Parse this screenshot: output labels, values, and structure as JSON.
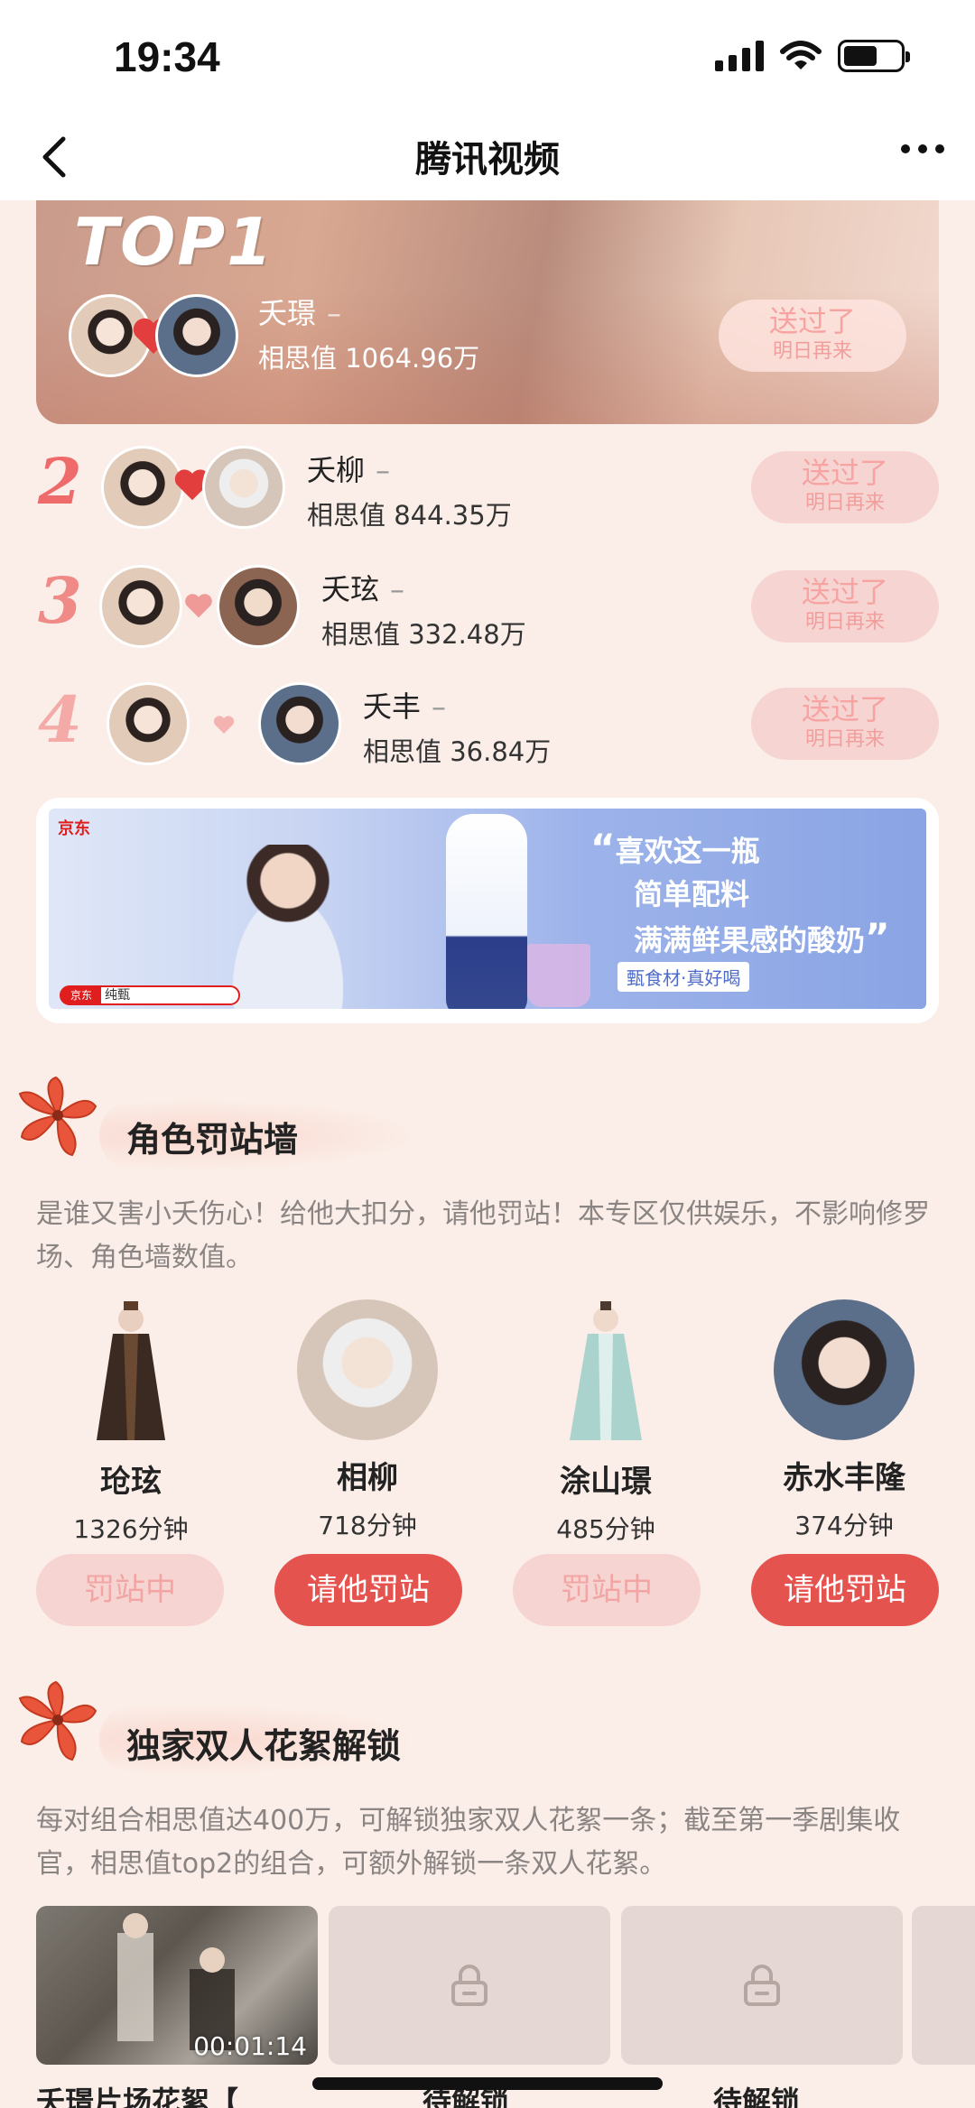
{
  "status_bar": {
    "time": "19:34"
  },
  "nav": {
    "title": "腾讯视频"
  },
  "ranking": {
    "top1": {
      "label": "TOP1",
      "name": "夭璟",
      "dash": "–",
      "score": "相思值 1064.96万",
      "btn_line1": "送过了",
      "btn_line2": "明日再来"
    },
    "others": [
      {
        "rank": "2",
        "name": "夭柳",
        "dash": "–",
        "score": "相思值 844.35万",
        "btn_line1": "送过了",
        "btn_line2": "明日再来"
      },
      {
        "rank": "3",
        "name": "夭玹",
        "dash": "–",
        "score": "相思值 332.48万",
        "btn_line1": "送过了",
        "btn_line2": "明日再来"
      },
      {
        "rank": "4",
        "name": "夭丰",
        "dash": "–",
        "score": "相思值 36.84万",
        "btn_line1": "送过了",
        "btn_line2": "明日再来"
      }
    ]
  },
  "ad": {
    "brand": "京东",
    "quote_open": "“",
    "line1": "喜欢这一瓶",
    "line2": "简单配料",
    "line3": "满满鲜果感的酸奶",
    "quote_close": "”",
    "tag": "甄食材·真好喝",
    "search": "纯甄"
  },
  "penalty_wall": {
    "title": "角色罚站墙",
    "desc": "是谁又害小夭伤心！给他大扣分，请他罚站！本专区仅供娱乐，不影响修罗场、角色墙数值。",
    "characters": [
      {
        "name": "玱玹",
        "minutes": "1326分钟",
        "button": "罚站中",
        "state": "on"
      },
      {
        "name": "相柳",
        "minutes": "718分钟",
        "button": "请他罚站",
        "state": "ask"
      },
      {
        "name": "涂山璟",
        "minutes": "485分钟",
        "button": "罚站中",
        "state": "on"
      },
      {
        "name": "赤水丰隆",
        "minutes": "374分钟",
        "button": "请他罚站",
        "state": "ask"
      }
    ]
  },
  "unlock": {
    "title": "独家双人花絮解锁",
    "desc": "每对组合相思值达400万，可解锁独家双人花絮一条；截至第一季剧集收官，相思值top2的组合，可额外解锁一条双人花絮。",
    "cards": [
      {
        "label": "夭璟片场花絮【",
        "duration": "00:01:14"
      },
      {
        "label": "待解锁"
      },
      {
        "label": "待解锁"
      }
    ]
  },
  "colors": {
    "accent": "#e5534f",
    "soft_pink": "#f5d4d2",
    "bg": "#fbeee8"
  }
}
